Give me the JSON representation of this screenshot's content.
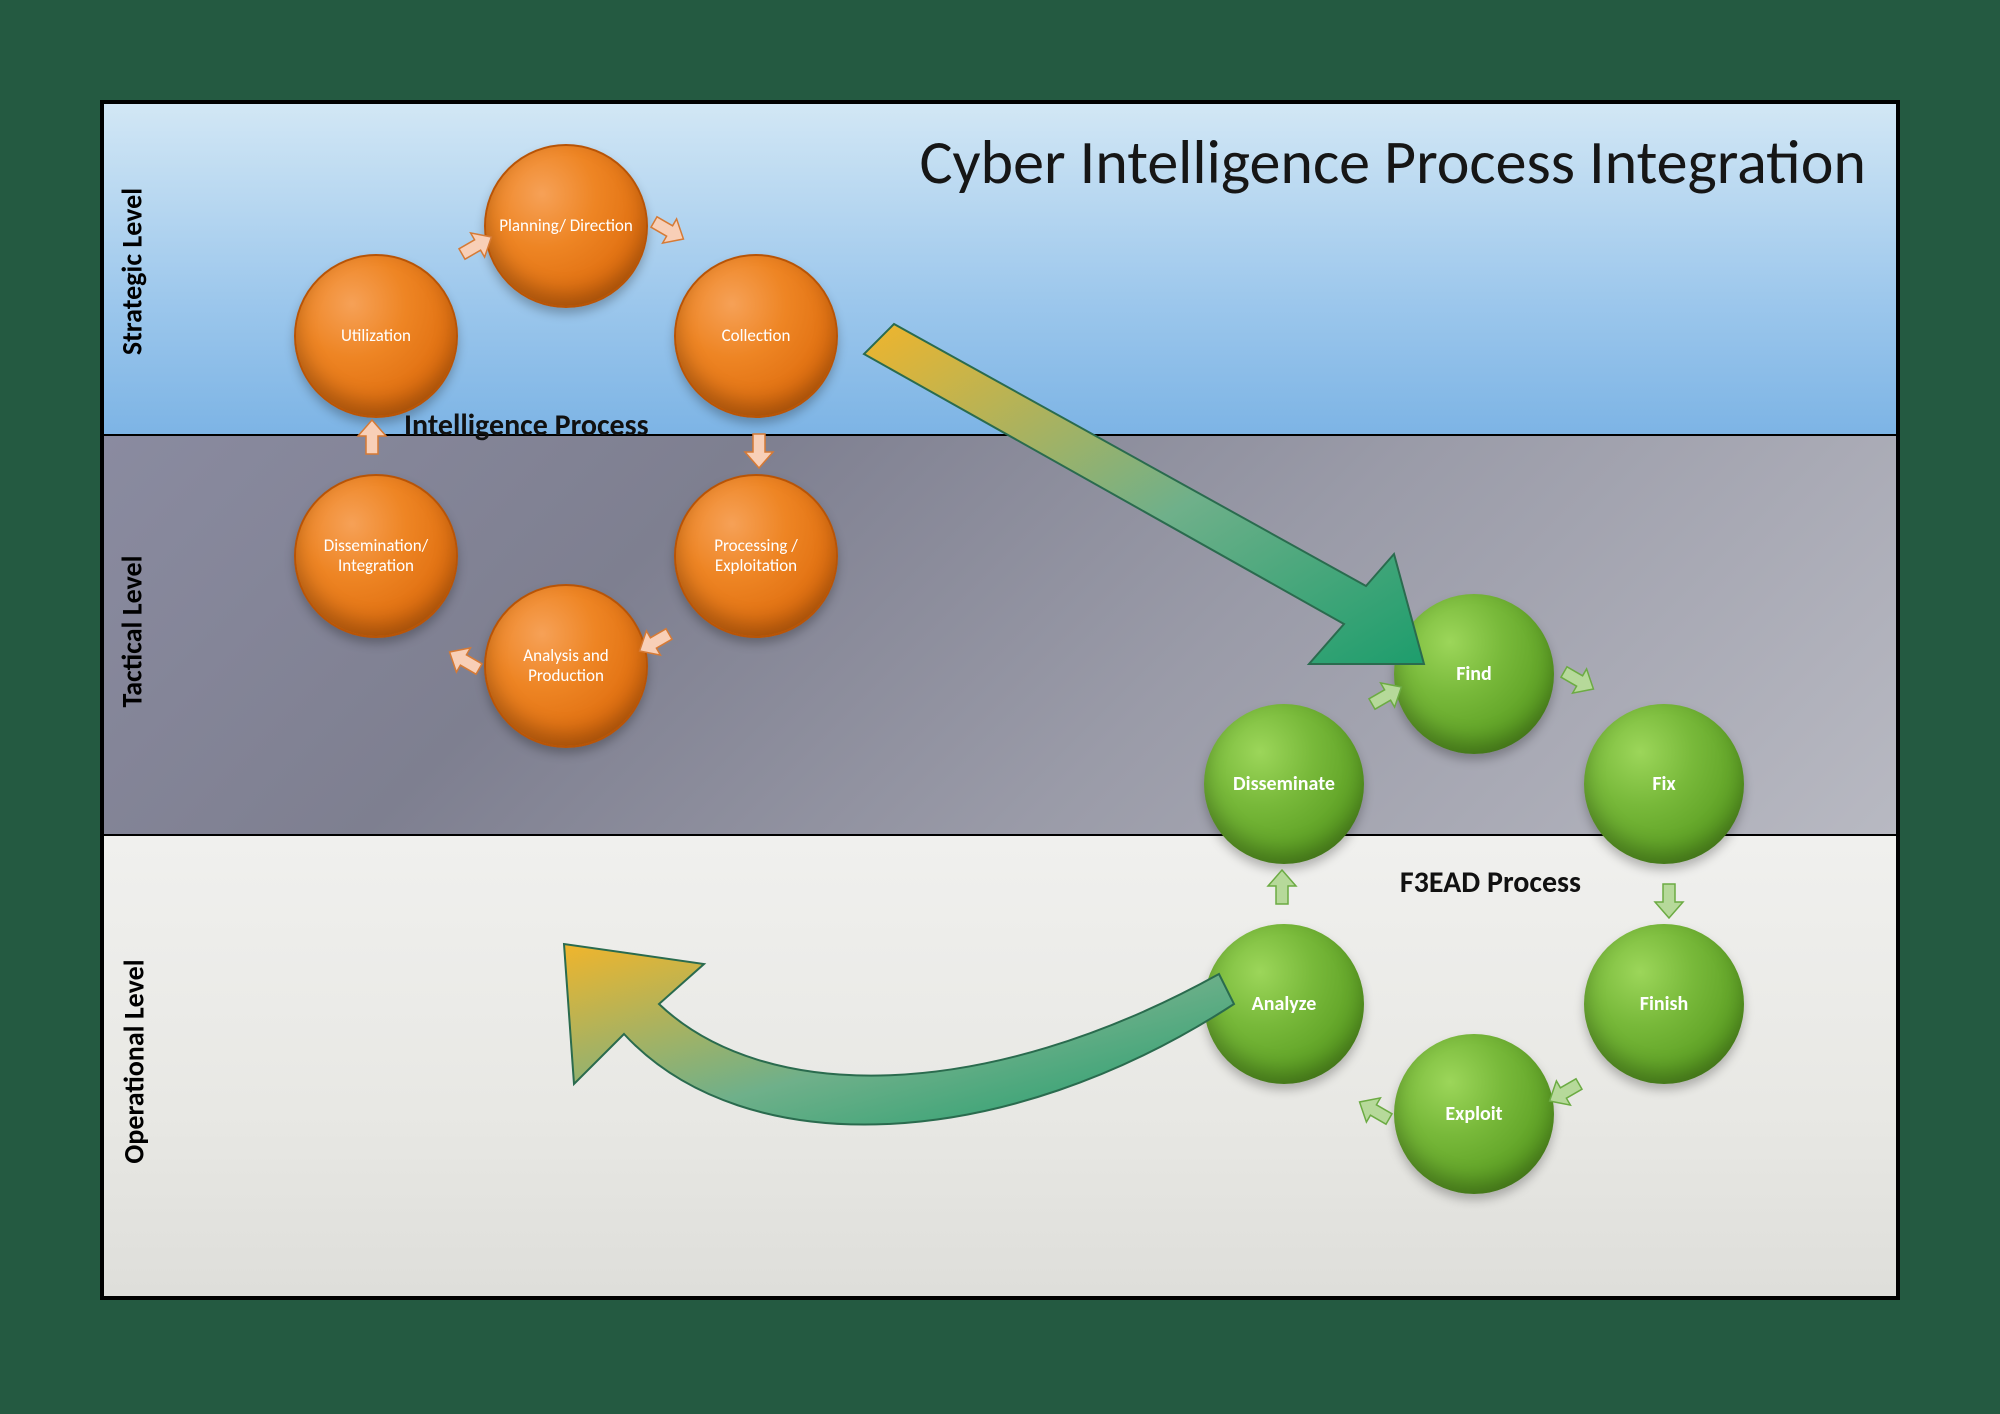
{
  "title": "Cyber Intelligence Process Integration",
  "levels": {
    "strategic": "Strategic Level",
    "tactical": "Tactical Level",
    "operational": "Operational Level"
  },
  "intel_process": {
    "label": "Intelligence Process",
    "nodes": [
      "Planning/\nDirection",
      "Collection",
      "Processing / Exploitation",
      "Analysis and Production",
      "Dissemination/\nIntegration",
      "Utilization"
    ]
  },
  "f3ead_process": {
    "label": "F3EAD Process",
    "nodes": [
      "Find",
      "Fix",
      "Finish",
      "Exploit",
      "Analyze",
      "Disseminate"
    ]
  },
  "colors": {
    "orange": "#ee8524",
    "green": "#6bab2e",
    "arrow_start": "#f0b52c",
    "arrow_end": "#1d9d6c",
    "band_top": "#a6cdee",
    "band_mid": "#87889a",
    "band_bot": "#ececea"
  },
  "chart_data": {
    "type": "diagram",
    "title": "Cyber Intelligence Process Integration",
    "levels": [
      "Strategic Level",
      "Tactical Level",
      "Operational Level"
    ],
    "cycles": [
      {
        "name": "Intelligence Process",
        "color": "orange",
        "steps": [
          "Planning/Direction",
          "Collection",
          "Processing / Exploitation",
          "Analysis and Production",
          "Dissemination/Integration",
          "Utilization"
        ],
        "span_levels": [
          "Strategic Level",
          "Tactical Level"
        ]
      },
      {
        "name": "F3EAD Process",
        "color": "green",
        "steps": [
          "Find",
          "Fix",
          "Finish",
          "Exploit",
          "Analyze",
          "Disseminate"
        ],
        "span_levels": [
          "Tactical Level",
          "Operational Level"
        ]
      }
    ],
    "connectors": [
      {
        "from": "Intelligence Process",
        "to": "F3EAD Process",
        "description": "straight gradient arrow, yellow→green"
      },
      {
        "from": "F3EAD Process",
        "to": "Intelligence Process",
        "description": "curved return gradient arrow, green→yellow"
      }
    ]
  }
}
